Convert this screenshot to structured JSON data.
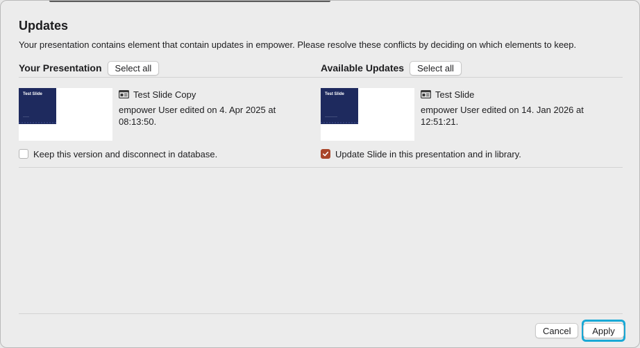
{
  "dialog": {
    "title": "Updates",
    "subtitle": "Your presentation contains element that contain updates in empower. Please resolve these conflicts by deciding on which elements to keep."
  },
  "left": {
    "header": "Your Presentation",
    "select_all": "Select all",
    "thumb_title": "Test Slide",
    "item_title": "Test Slide Copy",
    "item_meta": "empower User edited on 4. Apr 2025 at 08:13:50.",
    "checkbox_label": "Keep this version and disconnect in database.",
    "checked": false
  },
  "right": {
    "header": "Available Updates",
    "select_all": "Select all",
    "thumb_title": "Test Slide",
    "item_title": "Test Slide",
    "item_meta": "empower User edited on 14. Jan 2026 at 12:51:21.",
    "checkbox_label": "Update Slide in this presentation and in library.",
    "checked": true
  },
  "footer": {
    "cancel": "Cancel",
    "apply": "Apply"
  },
  "colors": {
    "accent_check": "#a9462a",
    "focus_ring": "#19a9d6",
    "slide_bg": "#1e2a5e"
  }
}
